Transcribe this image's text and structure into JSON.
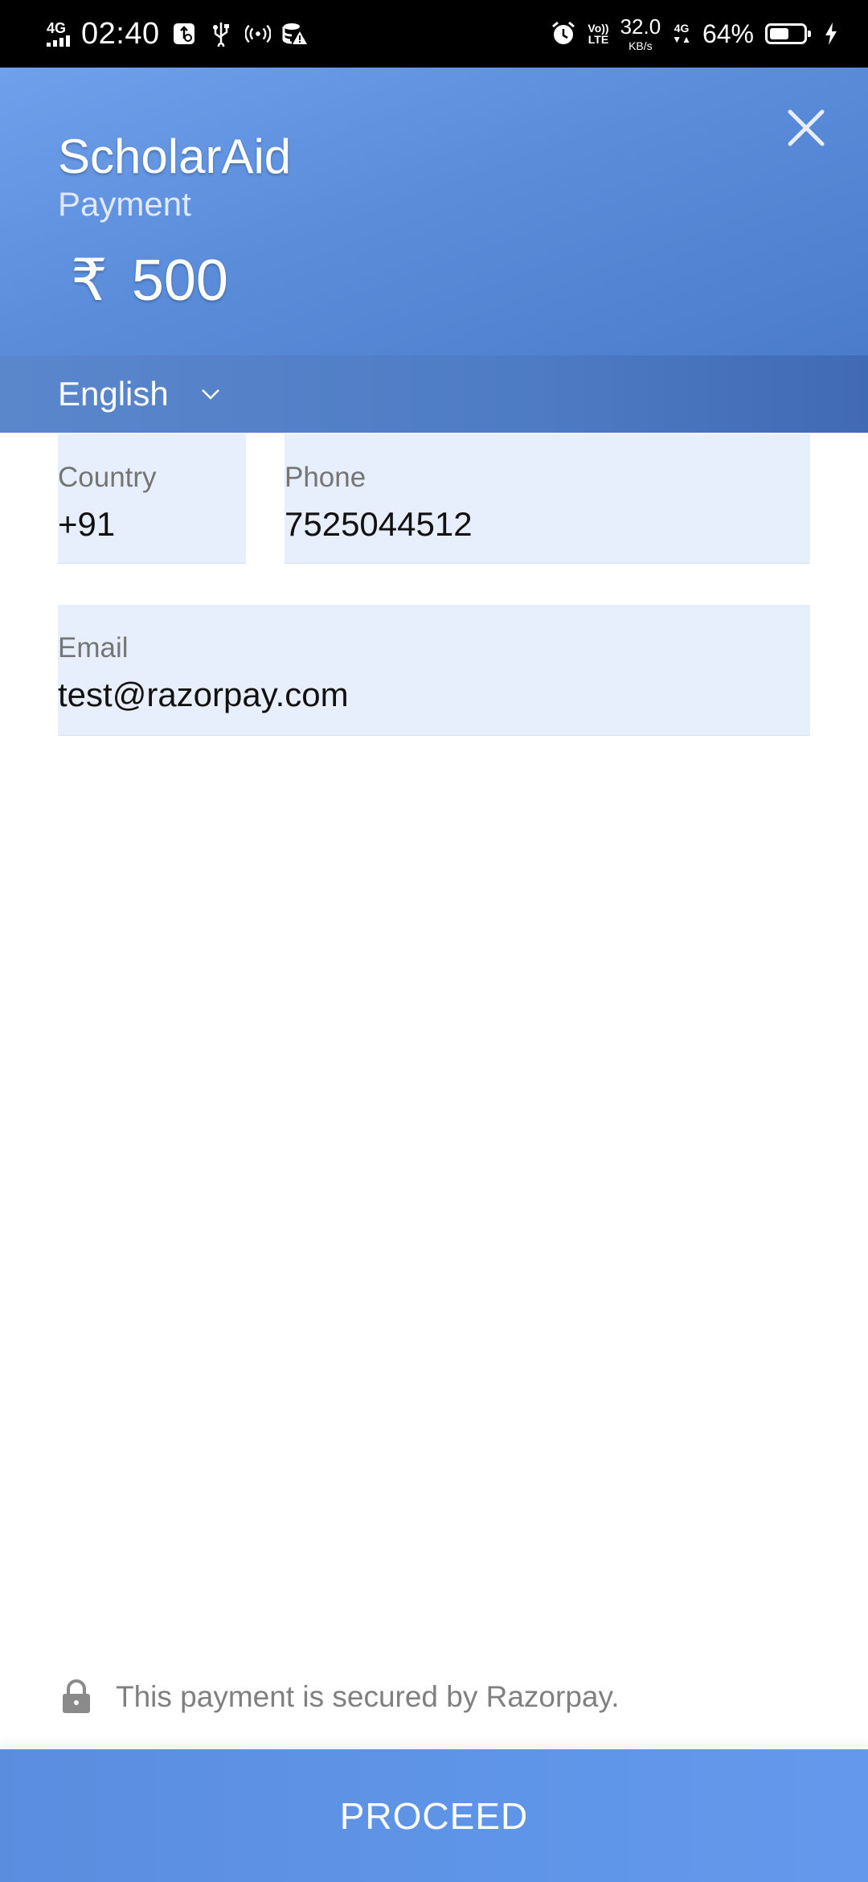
{
  "status_bar": {
    "network": "4G",
    "time": "02:40",
    "speed_value": "32.0",
    "speed_unit": "KB/s",
    "volte_top": "Vo))",
    "volte_bottom": "LTE",
    "network2": "4G",
    "battery": "64%",
    "battery_level": 0.64,
    "icons": [
      "signal-icon",
      "usb-settings-icon",
      "usb-icon",
      "hotspot-icon",
      "data-warning-icon",
      "alarm-icon",
      "charging-icon"
    ]
  },
  "header": {
    "merchant_name": "ScholarAid",
    "subtitle": "Payment",
    "currency_symbol": "₹",
    "amount": "500"
  },
  "language": {
    "selected": "English"
  },
  "form": {
    "country": {
      "label": "Country",
      "value": "+91"
    },
    "phone": {
      "label": "Phone",
      "value": "7525044512"
    },
    "email": {
      "label": "Email",
      "value": "test@razorpay.com"
    }
  },
  "footer": {
    "secure_text": "This payment is secured by Razorpay.",
    "proceed_label": "PROCEED"
  },
  "colors": {
    "header_bg": "#5b8ddb",
    "field_bg": "#e7effc",
    "proceed_bg": "#5f95e8"
  }
}
